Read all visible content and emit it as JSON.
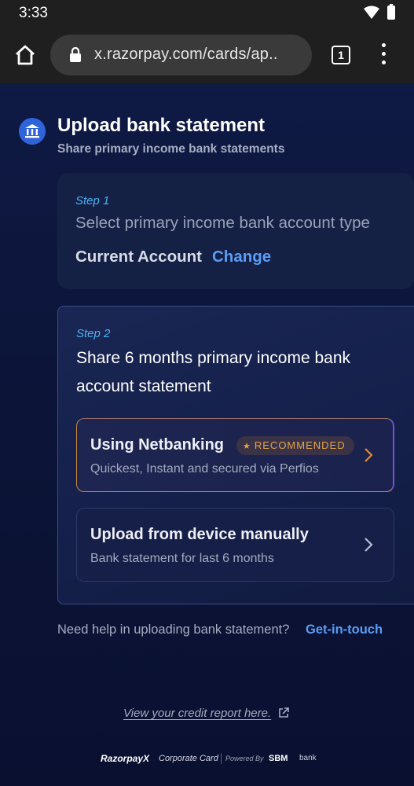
{
  "status_bar": {
    "time": "3:33"
  },
  "browser": {
    "url": "x.razorpay.com/cards/ap..",
    "tab_count": "1",
    "icons": {
      "home": "home-icon",
      "lock": "lock-icon",
      "menu": "more-vert-icon"
    }
  },
  "header": {
    "icon": "bank-icon",
    "title": "Upload bank statement",
    "subtitle": "Share primary income bank statements"
  },
  "step1": {
    "label": "Step 1",
    "description": "Select primary income bank account type",
    "account_type": "Current Account",
    "change_label": "Change"
  },
  "step2": {
    "label": "Step 2",
    "title": "Share 6 months primary income bank account statement",
    "options": [
      {
        "title": "Using Netbanking",
        "badge": "RECOMMENDED",
        "subtitle": "Quickest, Instant and secured via Perfios"
      },
      {
        "title": "Upload from device manually",
        "subtitle": "Bank statement for last 6 months"
      }
    ]
  },
  "help": {
    "text": "Need help in uploading bank statement?",
    "link": "Get-in-touch"
  },
  "credit_report_link": "View your credit report here.",
  "footer": {
    "brand": "RazorpayX",
    "product": "Corporate Card",
    "powered_by": "Powered By",
    "partner": "SBM",
    "partner_suffix": "bank"
  },
  "colors": {
    "background": "#0b1230",
    "accent_link": "#5b9cf5",
    "step_label": "#4fb1f0",
    "badge_text": "#e5a24a"
  }
}
